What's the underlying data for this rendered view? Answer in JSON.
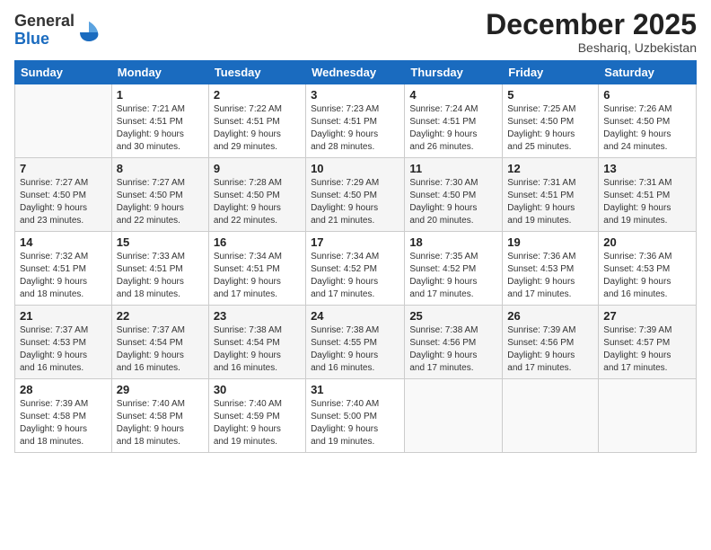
{
  "header": {
    "logo_general": "General",
    "logo_blue": "Blue",
    "month_title": "December 2025",
    "location": "Beshariq, Uzbekistan"
  },
  "days_of_week": [
    "Sunday",
    "Monday",
    "Tuesday",
    "Wednesday",
    "Thursday",
    "Friday",
    "Saturday"
  ],
  "weeks": [
    [
      {
        "day": "",
        "info": ""
      },
      {
        "day": "1",
        "info": "Sunrise: 7:21 AM\nSunset: 4:51 PM\nDaylight: 9 hours\nand 30 minutes."
      },
      {
        "day": "2",
        "info": "Sunrise: 7:22 AM\nSunset: 4:51 PM\nDaylight: 9 hours\nand 29 minutes."
      },
      {
        "day": "3",
        "info": "Sunrise: 7:23 AM\nSunset: 4:51 PM\nDaylight: 9 hours\nand 28 minutes."
      },
      {
        "day": "4",
        "info": "Sunrise: 7:24 AM\nSunset: 4:51 PM\nDaylight: 9 hours\nand 26 minutes."
      },
      {
        "day": "5",
        "info": "Sunrise: 7:25 AM\nSunset: 4:50 PM\nDaylight: 9 hours\nand 25 minutes."
      },
      {
        "day": "6",
        "info": "Sunrise: 7:26 AM\nSunset: 4:50 PM\nDaylight: 9 hours\nand 24 minutes."
      }
    ],
    [
      {
        "day": "7",
        "info": "Sunrise: 7:27 AM\nSunset: 4:50 PM\nDaylight: 9 hours\nand 23 minutes."
      },
      {
        "day": "8",
        "info": "Sunrise: 7:27 AM\nSunset: 4:50 PM\nDaylight: 9 hours\nand 22 minutes."
      },
      {
        "day": "9",
        "info": "Sunrise: 7:28 AM\nSunset: 4:50 PM\nDaylight: 9 hours\nand 22 minutes."
      },
      {
        "day": "10",
        "info": "Sunrise: 7:29 AM\nSunset: 4:50 PM\nDaylight: 9 hours\nand 21 minutes."
      },
      {
        "day": "11",
        "info": "Sunrise: 7:30 AM\nSunset: 4:50 PM\nDaylight: 9 hours\nand 20 minutes."
      },
      {
        "day": "12",
        "info": "Sunrise: 7:31 AM\nSunset: 4:51 PM\nDaylight: 9 hours\nand 19 minutes."
      },
      {
        "day": "13",
        "info": "Sunrise: 7:31 AM\nSunset: 4:51 PM\nDaylight: 9 hours\nand 19 minutes."
      }
    ],
    [
      {
        "day": "14",
        "info": "Sunrise: 7:32 AM\nSunset: 4:51 PM\nDaylight: 9 hours\nand 18 minutes."
      },
      {
        "day": "15",
        "info": "Sunrise: 7:33 AM\nSunset: 4:51 PM\nDaylight: 9 hours\nand 18 minutes."
      },
      {
        "day": "16",
        "info": "Sunrise: 7:34 AM\nSunset: 4:51 PM\nDaylight: 9 hours\nand 17 minutes."
      },
      {
        "day": "17",
        "info": "Sunrise: 7:34 AM\nSunset: 4:52 PM\nDaylight: 9 hours\nand 17 minutes."
      },
      {
        "day": "18",
        "info": "Sunrise: 7:35 AM\nSunset: 4:52 PM\nDaylight: 9 hours\nand 17 minutes."
      },
      {
        "day": "19",
        "info": "Sunrise: 7:36 AM\nSunset: 4:53 PM\nDaylight: 9 hours\nand 17 minutes."
      },
      {
        "day": "20",
        "info": "Sunrise: 7:36 AM\nSunset: 4:53 PM\nDaylight: 9 hours\nand 16 minutes."
      }
    ],
    [
      {
        "day": "21",
        "info": "Sunrise: 7:37 AM\nSunset: 4:53 PM\nDaylight: 9 hours\nand 16 minutes."
      },
      {
        "day": "22",
        "info": "Sunrise: 7:37 AM\nSunset: 4:54 PM\nDaylight: 9 hours\nand 16 minutes."
      },
      {
        "day": "23",
        "info": "Sunrise: 7:38 AM\nSunset: 4:54 PM\nDaylight: 9 hours\nand 16 minutes."
      },
      {
        "day": "24",
        "info": "Sunrise: 7:38 AM\nSunset: 4:55 PM\nDaylight: 9 hours\nand 16 minutes."
      },
      {
        "day": "25",
        "info": "Sunrise: 7:38 AM\nSunset: 4:56 PM\nDaylight: 9 hours\nand 17 minutes."
      },
      {
        "day": "26",
        "info": "Sunrise: 7:39 AM\nSunset: 4:56 PM\nDaylight: 9 hours\nand 17 minutes."
      },
      {
        "day": "27",
        "info": "Sunrise: 7:39 AM\nSunset: 4:57 PM\nDaylight: 9 hours\nand 17 minutes."
      }
    ],
    [
      {
        "day": "28",
        "info": "Sunrise: 7:39 AM\nSunset: 4:58 PM\nDaylight: 9 hours\nand 18 minutes."
      },
      {
        "day": "29",
        "info": "Sunrise: 7:40 AM\nSunset: 4:58 PM\nDaylight: 9 hours\nand 18 minutes."
      },
      {
        "day": "30",
        "info": "Sunrise: 7:40 AM\nSunset: 4:59 PM\nDaylight: 9 hours\nand 19 minutes."
      },
      {
        "day": "31",
        "info": "Sunrise: 7:40 AM\nSunset: 5:00 PM\nDaylight: 9 hours\nand 19 minutes."
      },
      {
        "day": "",
        "info": ""
      },
      {
        "day": "",
        "info": ""
      },
      {
        "day": "",
        "info": ""
      }
    ]
  ]
}
